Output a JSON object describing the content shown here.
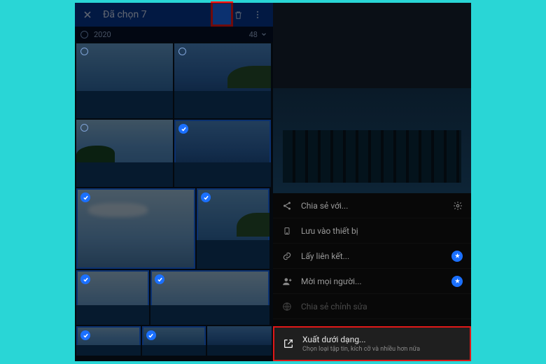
{
  "header": {
    "title": "Đã chọn 7"
  },
  "subbar": {
    "year": "2020",
    "count": "48"
  },
  "thumbs": [
    {
      "selected": false,
      "style": "sky1 sea",
      "w": 138,
      "h": 107
    },
    {
      "selected": false,
      "style": "sky2 sea coast",
      "w": 138,
      "h": 107
    },
    {
      "selected": false,
      "style": "sky3 sea hill",
      "w": 138,
      "h": 96
    },
    {
      "selected": true,
      "style": "sky2 sea",
      "w": 138,
      "h": 96
    },
    {
      "selected": true,
      "style": "sky4 sea cloud",
      "w": 170,
      "h": 115
    },
    {
      "selected": true,
      "style": "sky1 sea coast",
      "w": 104,
      "h": 115
    },
    {
      "selected": true,
      "style": "sky4 sea",
      "w": 104,
      "h": 78
    },
    {
      "selected": true,
      "style": "sky4 sea",
      "w": 170,
      "h": 78
    },
    {
      "selected": true,
      "style": "sky3 sea",
      "w": 92,
      "h": 42
    },
    {
      "selected": true,
      "style": "sky1 sea",
      "w": 92,
      "h": 42
    },
    {
      "selected": false,
      "style": "sky2 sea",
      "w": 92,
      "h": 42
    }
  ],
  "menu": {
    "share_with": "Chia sẻ với...",
    "save_to_device": "Lưu vào thiết bị",
    "get_link": "Lấy liên kết...",
    "invite_people": "Mời mọi người...",
    "share_edits": "Chia sẻ chỉnh sửa",
    "export": {
      "title": "Xuất dưới dạng...",
      "subtitle": "Chọn loại tập tin, kích cỡ và nhiều hơn nữa"
    }
  }
}
